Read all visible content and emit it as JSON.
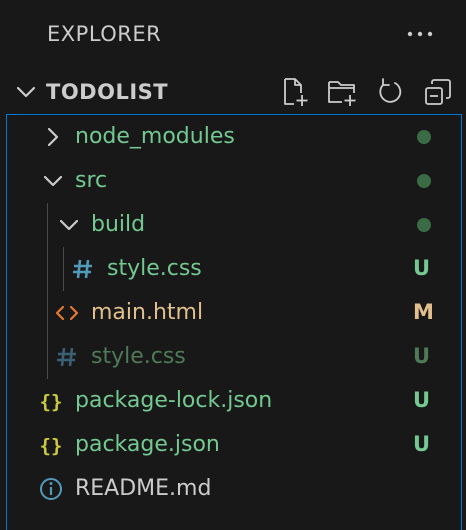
{
  "explorer": {
    "title": "EXPLORER",
    "more_icon": "ellipsis-icon"
  },
  "section": {
    "title": "TODOLIST",
    "actions": [
      {
        "name": "new-file",
        "icon": "new-file-icon"
      },
      {
        "name": "new-folder",
        "icon": "new-folder-icon"
      },
      {
        "name": "refresh",
        "icon": "refresh-icon"
      },
      {
        "name": "collapse-all",
        "icon": "collapse-all-icon"
      }
    ]
  },
  "tree": {
    "items": [
      {
        "label": "node_modules",
        "type": "folder",
        "expanded": false,
        "indent": 0,
        "decoration": "dot"
      },
      {
        "label": "src",
        "type": "folder",
        "expanded": true,
        "indent": 0,
        "decoration": "dot"
      },
      {
        "label": "build",
        "type": "folder",
        "expanded": true,
        "indent": 1,
        "decoration": "dot"
      },
      {
        "label": "style.css",
        "type": "css",
        "indent": 2,
        "decoration": "U"
      },
      {
        "label": "main.html",
        "type": "html",
        "indent": 1,
        "decoration": "M"
      },
      {
        "label": "style.css",
        "type": "css",
        "indent": 1,
        "decoration": "U"
      },
      {
        "label": "package-lock.json",
        "type": "json",
        "indent": 0,
        "decoration": "U"
      },
      {
        "label": "package.json",
        "type": "json",
        "indent": 0,
        "decoration": "U"
      },
      {
        "label": "README.md",
        "type": "info",
        "indent": 0,
        "decoration": ""
      }
    ]
  },
  "colors": {
    "untracked": "#73c991",
    "modified": "#e2c08d",
    "focus_border": "#0078d4",
    "background": "#181818"
  }
}
